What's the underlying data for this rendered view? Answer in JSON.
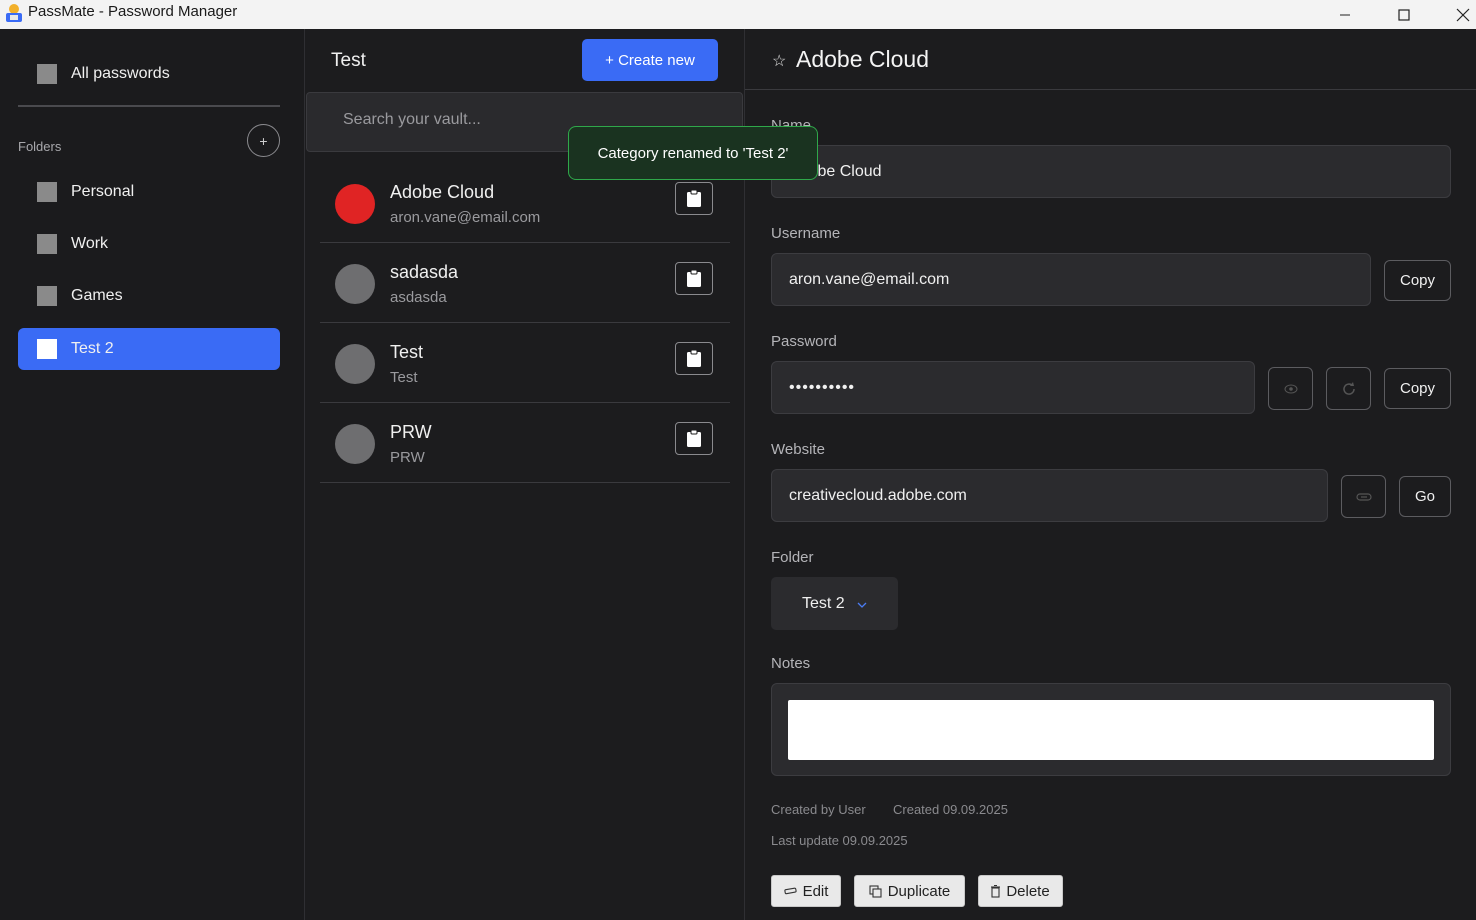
{
  "window": {
    "title": "PassMate - Password Manager"
  },
  "sidebar": {
    "all_passwords": "All passwords",
    "folders_label": "Folders",
    "add_folder": "+",
    "folders": [
      {
        "label": "Personal"
      },
      {
        "label": "Work"
      },
      {
        "label": "Games"
      },
      {
        "label": "Test 2",
        "active": true
      }
    ]
  },
  "list": {
    "title": "Test",
    "create_label": "+ Create new",
    "search_placeholder": "Search your vault...",
    "entries": [
      {
        "name": "Adobe Cloud",
        "sub": "aron.vane@email.com",
        "avatar_color": "#e02424"
      },
      {
        "name": "sadasda",
        "sub": "asdasda",
        "avatar_color": "#6e6e70"
      },
      {
        "name": "Test",
        "sub": "Test",
        "avatar_color": "#6e6e70"
      },
      {
        "name": "PRW",
        "sub": "PRW",
        "avatar_color": "#6e6e70"
      }
    ]
  },
  "toast": {
    "message": "Category renamed to 'Test 2'"
  },
  "detail": {
    "star": "☆",
    "title": "Adobe Cloud",
    "name_label": "Name",
    "name_value": "Adobe Cloud",
    "username_label": "Username",
    "username_value": "aron.vane@email.com",
    "password_label": "Password",
    "password_value": "••••••••••",
    "website_label": "Website",
    "website_value": "creativecloud.adobe.com",
    "folder_label": "Folder",
    "folder_value": "Test 2",
    "notes_label": "Notes",
    "notes_value": "",
    "copy_label": "Copy",
    "go_label": "Go",
    "created_by": "Created by User",
    "created_on": "Created 09.09.2025",
    "last_update": "Last update 09.09.2025",
    "edit_label": "Edit",
    "duplicate_label": "Duplicate",
    "delete_label": "Delete"
  },
  "colors": {
    "accent": "#3a6bf5",
    "toast_border": "#2fa84a",
    "favorite_avatar": "#e02424"
  }
}
